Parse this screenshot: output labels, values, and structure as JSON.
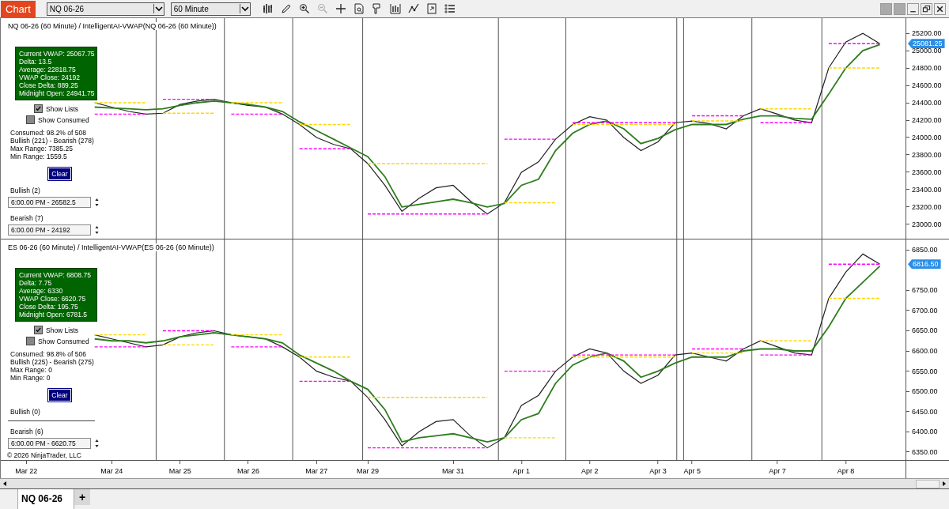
{
  "toolbar": {
    "title": "Chart",
    "instrument": "NQ 06-26",
    "interval": "60 Minute"
  },
  "panels": [
    {
      "title": "NQ 06-26 (60 Minute) / IntelligentAI-VWAP(NQ 06-26 (60 Minute))",
      "info_lines": [
        "Current VWAP: 25067.75",
        "Delta: 13.5",
        "Average: 22818.75",
        "VWAP Close: 24192",
        "Close Delta: 889.25",
        "Midnight Open: 24941.75"
      ],
      "show_lists": {
        "label": "Show Lists",
        "checked": true
      },
      "show_consumed": {
        "label": "Show Consumed",
        "checked": false
      },
      "stats": [
        "Consumed: 98.2% of 508",
        "Bullish (221) - Bearish (278)",
        "Max Range: 7385.25",
        "Min Range: 1559.5"
      ],
      "clear_button": "Clear",
      "bullish": {
        "label": "Bullish (2)",
        "value": "6:00.00 PM - 26582.5"
      },
      "bearish": {
        "label": "Bearish (7)",
        "value": "6:00.00 PM - 24192"
      },
      "price_badge": "25081.25",
      "chart_data": {
        "type": "line",
        "ylim": [
          22835,
          25374
        ],
        "categories": [
          null,
          null,
          null,
          null,
          null,
          null,
          null,
          null,
          null,
          null,
          null,
          null,
          null,
          null,
          null,
          null,
          null,
          null,
          null,
          null,
          null,
          null,
          null,
          null,
          null,
          null,
          null,
          null,
          null,
          null,
          null,
          null,
          null,
          null,
          null,
          null,
          null,
          null,
          null,
          null,
          null,
          null,
          null,
          null,
          null,
          null,
          null,
          null,
          null,
          null,
          null,
          null
        ],
        "yticks": [
          {
            "value": 23000,
            "label": "23000.00"
          },
          {
            "value": 23200,
            "label": "23200.00"
          },
          {
            "value": 23400,
            "label": "23400.00"
          },
          {
            "value": 23600,
            "label": "23600.00"
          },
          {
            "value": 23800,
            "label": "23800.00"
          },
          {
            "value": 24000,
            "label": "24000.00"
          },
          {
            "value": 24200,
            "label": "24200.00"
          },
          {
            "value": 24400,
            "label": "24400.00"
          },
          {
            "value": 24600,
            "label": "24600.00"
          },
          {
            "value": 24800,
            "label": "24800.00"
          },
          {
            "value": 25000,
            "label": "25000.00"
          },
          {
            "value": 25200,
            "label": "25200.00"
          }
        ],
        "series": [
          {
            "color": "#222222",
            "values": [
              null,
              null,
              null,
              null,
              24400,
              24350,
              24300,
              24270,
              24280,
              24380,
              24420,
              24440,
              24400,
              24370,
              24350,
              24270,
              24150,
              24000,
              23920,
              23870,
              23700,
              23450,
              23150,
              23300,
              23420,
              23450,
              23270,
              23120,
              23250,
              23600,
              23720,
              23980,
              24150,
              24240,
              24200,
              24000,
              23850,
              23950,
              24170,
              24190,
              24160,
              24100,
              24250,
              24330,
              24270,
              24200,
              24170,
              24800,
              25100,
              25200,
              25080,
              null
            ]
          },
          {
            "color": "#2e7d1e",
            "values": [
              null,
              null,
              null,
              null,
              24350,
              24340,
              24330,
              24320,
              24330,
              24370,
              24400,
              24420,
              24400,
              24380,
              24350,
              24300,
              24180,
              24080,
              23980,
              23880,
              23780,
              23550,
              23200,
              23230,
              23260,
              23290,
              23250,
              23200,
              23240,
              23450,
              23520,
              23850,
              24050,
              24150,
              24190,
              24100,
              23930,
              23990,
              24090,
              24150,
              24150,
              24150,
              24210,
              24250,
              24250,
              24220,
              24210,
              24500,
              24800,
              25000,
              25070,
              null
            ]
          },
          {
            "color": "#ffd700",
            "line_style": "dashed",
            "values": [
              null,
              null,
              null,
              null,
              24400,
              24400,
              24400,
              24400,
              24280,
              24280,
              24280,
              24280,
              24400,
              24400,
              24400,
              24400,
              24150,
              24150,
              24150,
              24150,
              23700,
              23700,
              23700,
              23700,
              23700,
              23700,
              23700,
              23700,
              23250,
              23250,
              23250,
              23250,
              24150,
              24150,
              24150,
              24150,
              24150,
              24150,
              24150,
              24190,
              24190,
              24190,
              24190,
              24330,
              24330,
              24330,
              24330,
              24800,
              24800,
              24800,
              24800,
              null
            ]
          },
          {
            "color": "#ff00ff",
            "line_style": "dashed",
            "values": [
              null,
              null,
              null,
              null,
              24270,
              24270,
              24270,
              24270,
              24440,
              24440,
              24440,
              24440,
              24270,
              24270,
              24270,
              24270,
              23870,
              23870,
              23870,
              23870,
              23120,
              23120,
              23120,
              23120,
              23120,
              23120,
              23120,
              23120,
              23980,
              23980,
              23980,
              23980,
              24170,
              24170,
              24170,
              24170,
              24170,
              24170,
              24170,
              24250,
              24250,
              24250,
              24250,
              24170,
              24170,
              24170,
              24170,
              25080,
              25080,
              25080,
              25080,
              null
            ]
          }
        ]
      }
    },
    {
      "title": "ES 06-26 (60 Minute) / IntelligentAI-VWAP(ES 06-26 (60 Minute))",
      "info_lines": [
        "Current VWAP: 6808.75",
        "Delta: 7.75",
        "Average: 6330",
        "VWAP Close: 6620.75",
        "Close Delta: 195.75",
        "Midnight Open: 6781.5"
      ],
      "show_lists": {
        "label": "Show Lists",
        "checked": true
      },
      "show_consumed": {
        "label": "Show Consumed",
        "checked": false
      },
      "stats": [
        "Consumed: 98.8% of 506",
        "Bullish (225) - Bearish (275)",
        "Max Range: 0",
        "Min Range: 0"
      ],
      "clear_button": "Clear",
      "bullish": {
        "label": "Bullish (0)"
      },
      "bearish": {
        "label": "Bearish (6)",
        "value": "6:00.00 PM - 6620.75"
      },
      "price_badge": "6816.50",
      "chart_data": {
        "type": "line",
        "ylim": [
          6330,
          6876
        ],
        "categories": [
          "Mar 22",
          null,
          null,
          null,
          null,
          "Mar 24",
          null,
          null,
          null,
          "Mar 25",
          null,
          null,
          null,
          "Mar 26",
          null,
          null,
          null,
          "Mar 27",
          null,
          null,
          "Mar 29",
          null,
          null,
          null,
          null,
          "Mar 31",
          null,
          null,
          null,
          "Apr 1",
          null,
          null,
          null,
          "Apr 2",
          null,
          null,
          null,
          "Apr 3",
          null,
          "Apr 5",
          null,
          null,
          null,
          null,
          "Apr 7",
          null,
          null,
          null,
          "Apr 8",
          null,
          null,
          null
        ],
        "yticks": [
          {
            "value": 6350,
            "label": "6350.00"
          },
          {
            "value": 6400,
            "label": "6400.00"
          },
          {
            "value": 6450,
            "label": "6450.00"
          },
          {
            "value": 6500,
            "label": "6500.00"
          },
          {
            "value": 6550,
            "label": "6550.00"
          },
          {
            "value": 6600,
            "label": "6600.00"
          },
          {
            "value": 6650,
            "label": "6650.00"
          },
          {
            "value": 6700,
            "label": "6700.00"
          },
          {
            "value": 6750,
            "label": "6750.00"
          },
          {
            "value": 6850,
            "label": "6850.00"
          }
        ],
        "series": [
          {
            "color": "#222222",
            "values": [
              null,
              null,
              null,
              null,
              6640,
              6630,
              6620,
              6610,
              6615,
              6635,
              6645,
              6650,
              6640,
              6635,
              6630,
              6610,
              6585,
              6550,
              6535,
              6525,
              6485,
              6430,
              6365,
              6400,
              6425,
              6430,
              6390,
              6360,
              6385,
              6465,
              6490,
              6550,
              6585,
              6605,
              6595,
              6550,
              6520,
              6540,
              6590,
              6595,
              6585,
              6575,
              6605,
              6625,
              6610,
              6595,
              6590,
              6730,
              6795,
              6840,
              6815,
              null
            ]
          },
          {
            "color": "#2e7d1e",
            "values": [
              null,
              null,
              null,
              null,
              6630,
              6625,
              6625,
              6620,
              6625,
              6635,
              6640,
              6645,
              6640,
              6635,
              6630,
              6620,
              6590,
              6570,
              6550,
              6525,
              6505,
              6455,
              6375,
              6385,
              6390,
              6395,
              6385,
              6375,
              6385,
              6430,
              6445,
              6520,
              6565,
              6585,
              6595,
              6575,
              6535,
              6550,
              6570,
              6585,
              6585,
              6585,
              6600,
              6605,
              6605,
              6600,
              6600,
              6660,
              6730,
              6770,
              6810,
              null
            ]
          },
          {
            "color": "#ffd700",
            "line_style": "dashed",
            "values": [
              null,
              null,
              null,
              null,
              6640,
              6640,
              6640,
              6640,
              6615,
              6615,
              6615,
              6615,
              6640,
              6640,
              6640,
              6640,
              6585,
              6585,
              6585,
              6585,
              6485,
              6485,
              6485,
              6485,
              6485,
              6485,
              6485,
              6485,
              6385,
              6385,
              6385,
              6385,
              6585,
              6585,
              6585,
              6585,
              6585,
              6585,
              6585,
              6595,
              6595,
              6595,
              6595,
              6625,
              6625,
              6625,
              6625,
              6730,
              6730,
              6730,
              6730,
              null
            ]
          },
          {
            "color": "#ff00ff",
            "line_style": "dashed",
            "values": [
              null,
              null,
              null,
              null,
              6610,
              6610,
              6610,
              6610,
              6650,
              6650,
              6650,
              6650,
              6610,
              6610,
              6610,
              6610,
              6525,
              6525,
              6525,
              6525,
              6360,
              6360,
              6360,
              6360,
              6360,
              6360,
              6360,
              6360,
              6550,
              6550,
              6550,
              6550,
              6590,
              6590,
              6590,
              6590,
              6590,
              6590,
              6590,
              6605,
              6605,
              6605,
              6605,
              6590,
              6590,
              6590,
              6590,
              6815,
              6815,
              6815,
              6815,
              null
            ]
          }
        ]
      }
    }
  ],
  "copyright": "© 2026 NinjaTrader, LLC",
  "tabs": [
    {
      "label": "NQ 06-26",
      "selected": true
    }
  ],
  "add_tab": "+"
}
